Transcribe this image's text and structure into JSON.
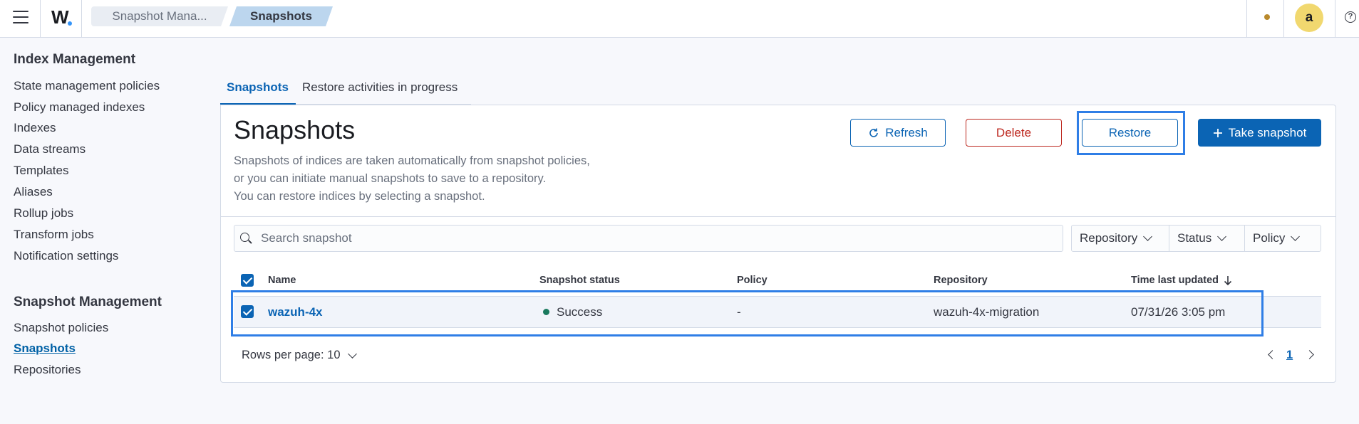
{
  "header": {
    "logo": "W",
    "breadcrumbs": [
      "Snapshot Mana...",
      "Snapshots"
    ],
    "avatar_initial": "a",
    "help_icon": "?"
  },
  "sidebar": {
    "index_management": {
      "title": "Index Management",
      "items": [
        "State management policies",
        "Policy managed indexes",
        "Indexes",
        "Data streams",
        "Templates",
        "Aliases",
        "Rollup jobs",
        "Transform jobs",
        "Notification settings"
      ]
    },
    "snapshot_management": {
      "title": "Snapshot Management",
      "items": [
        "Snapshot policies",
        "Snapshots",
        "Repositories"
      ],
      "active": "Snapshots"
    }
  },
  "tabs": [
    "Snapshots",
    "Restore activities in progress"
  ],
  "panel": {
    "title": "Snapshots",
    "description": [
      "Snapshots of indices are taken automatically from snapshot policies,",
      "or you can initiate manual snapshots to save to a repository.",
      "You can restore indices by selecting a snapshot."
    ],
    "buttons": {
      "refresh": "Refresh",
      "delete": "Delete",
      "restore": "Restore",
      "take_snapshot": "Take snapshot"
    }
  },
  "search": {
    "placeholder": "Search snapshot",
    "value": ""
  },
  "filters": [
    "Repository",
    "Status",
    "Policy"
  ],
  "table": {
    "columns": [
      "Name",
      "Snapshot status",
      "Policy",
      "Repository",
      "Time last updated"
    ],
    "rows": [
      {
        "name": "wazuh-4x",
        "status": "Success",
        "policy": "-",
        "repository": "wazuh-4x-migration",
        "time": "07/31/26 3:05 pm",
        "selected": true
      }
    ]
  },
  "pagination": {
    "rows_per_page": "Rows per page: 10",
    "current_page": "1"
  },
  "colors": {
    "primary": "#0b64b4",
    "danger": "#bd271e",
    "success": "#1a7a5e",
    "highlight": "#2f7ee6"
  }
}
